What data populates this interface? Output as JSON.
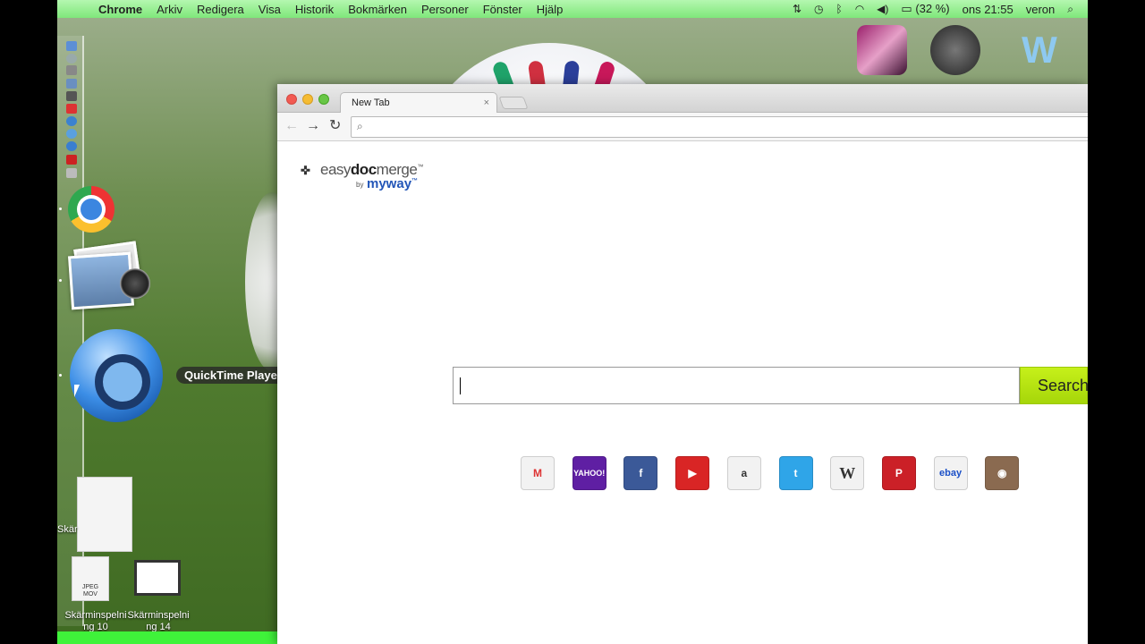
{
  "menubar": {
    "app_name": "Chrome",
    "menus": [
      "Arkiv",
      "Redigera",
      "Visa",
      "Historik",
      "Bokmärken",
      "Personer",
      "Fönster",
      "Hjälp"
    ],
    "battery": "(32 %)",
    "clock": "ons 21:55",
    "user": "veron"
  },
  "dock": {
    "tooltip": "QuickTime Player"
  },
  "desktop": {
    "file_label_partial": "Skär",
    "item1_label_line1": "Skärminspelni",
    "item1_label_line2": "ng 10",
    "item2_label_line1": "Skärminspelni",
    "item2_label_line2": "ng 14",
    "item1_badge": "JPEG",
    "item1_badge2": "MOV"
  },
  "browser": {
    "tab_title": "New Tab",
    "tab_close": "×",
    "omnibox_value": "",
    "logo_part1": "easy",
    "logo_part2": "doc",
    "logo_part3": "merge",
    "logo_tm": "™",
    "logo_by": "by",
    "logo_myway": "myway",
    "search_value": "",
    "search_button": "Search",
    "shortcuts": [
      {
        "name": "Gmail",
        "glyph": "M",
        "color": "#f2f2f2"
      },
      {
        "name": "Yahoo",
        "glyph": "YAHOO!",
        "color": "#5f1fa3"
      },
      {
        "name": "Facebook",
        "glyph": "f",
        "color": "#3b5998"
      },
      {
        "name": "YouTube",
        "glyph": "▶",
        "color": "#d92525"
      },
      {
        "name": "Amazon",
        "glyph": "a",
        "color": "#f2f2f2"
      },
      {
        "name": "Twitter",
        "glyph": "t",
        "color": "#2fa5e8"
      },
      {
        "name": "Wikipedia",
        "glyph": "W",
        "color": "#f2f2f2"
      },
      {
        "name": "Pinterest",
        "glyph": "P",
        "color": "#cb2027"
      },
      {
        "name": "eBay",
        "glyph": "ebay",
        "color": "#f2f2f2"
      },
      {
        "name": "Instagram",
        "glyph": "◉",
        "color": "#8a6a50"
      }
    ]
  },
  "colors": {
    "menubar": "#8ff08a",
    "search_button": "#b5e312",
    "myway_blue": "#2356b8"
  }
}
